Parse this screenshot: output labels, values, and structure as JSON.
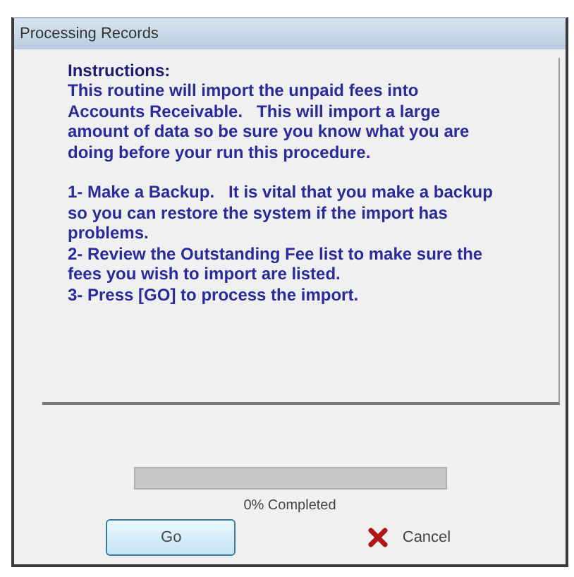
{
  "window": {
    "title": "Processing Records"
  },
  "instructions": {
    "heading": "Instructions:",
    "intro": "This routine will import the unpaid fees into Accounts Receivable.   This will import a large amount of data so be sure you know what you are doing before your run this procedure.",
    "steps": [
      "1- Make a Backup.   It is vital that you make a backup so you can restore the system if the import has problems.",
      "2- Review the Outstanding Fee list to make sure the fees you wish to import are listed.",
      "3- Press [GO] to process the import."
    ]
  },
  "progress": {
    "level": 0,
    "label": "0% Completed"
  },
  "buttons": [
    {
      "kind": "go",
      "label": "Go"
    },
    {
      "kind": "cancel",
      "label": "Cancel"
    }
  ]
}
